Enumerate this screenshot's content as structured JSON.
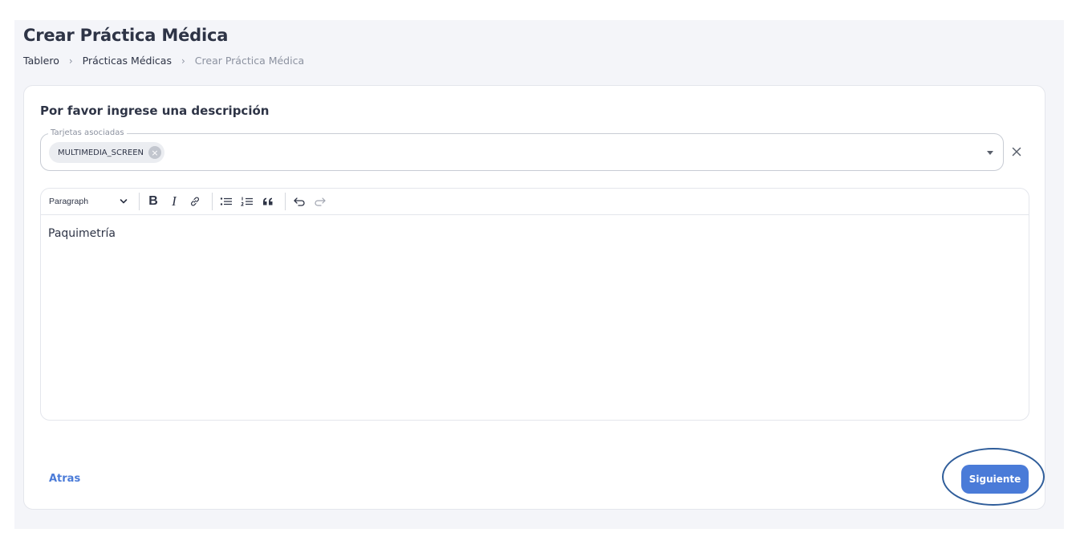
{
  "page": {
    "title": "Crear Práctica Médica",
    "breadcrumb": [
      "Tablero",
      "Prácticas Médicas",
      "Crear Práctica Médica"
    ]
  },
  "form": {
    "heading": "Por favor ingrese una descripción",
    "tags_field": {
      "label": "Tarjetas asociadas",
      "selected_chips": [
        "MULTIMEDIA_SCREEN"
      ]
    },
    "editor": {
      "block_format": "Paragraph",
      "toolbar_icons": [
        "bold-icon",
        "italic-icon",
        "link-icon",
        "bulleted-list-icon",
        "numbered-list-icon",
        "blockquote-icon",
        "undo-icon",
        "redo-icon"
      ],
      "content": "Paquimetría"
    },
    "back_label": "Atras",
    "next_label": "Siguiente"
  },
  "colors": {
    "accent": "#4a7bd8",
    "highlight_ring": "#2f5d9a",
    "page_background": "#f4f5f9"
  }
}
